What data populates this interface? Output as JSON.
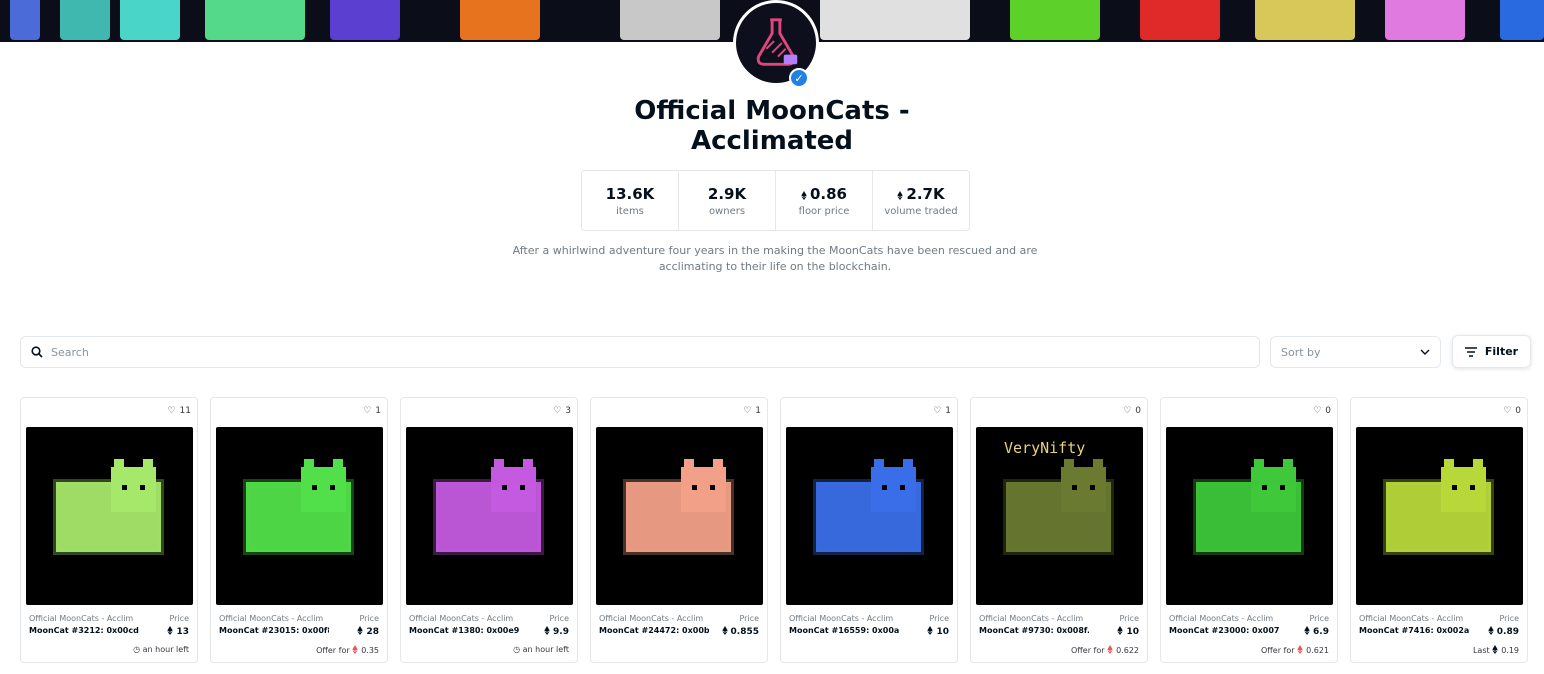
{
  "collection": {
    "title": "Official MoonCats - Acclimated",
    "description": "After a whirlwind adventure four years in the making the MoonCats have been rescued and are acclimating to their life on the blockchain.",
    "stats": [
      {
        "value": "13.6K",
        "label": "items",
        "eth": false
      },
      {
        "value": "2.9K",
        "label": "owners",
        "eth": false
      },
      {
        "value": "0.86",
        "label": "floor price",
        "eth": true
      },
      {
        "value": "2.7K",
        "label": "volume traded",
        "eth": true
      }
    ]
  },
  "toolbar": {
    "search_placeholder": "Search",
    "sort_label": "Sort by",
    "filter_label": "Filter"
  },
  "colors": {
    "accent": "#2081e2",
    "offer_eth": "#eb5757"
  },
  "items": [
    {
      "favorites": "11",
      "collection": "Official MoonCats - Acclim",
      "name": "MoonCat #3212: 0x00cd...",
      "price_label": "Price",
      "price": "13",
      "footer_type": "time",
      "footer_label": "",
      "footer_value": "an hour left",
      "cat_color": "#a6e86a"
    },
    {
      "favorites": "1",
      "collection": "Official MoonCats - Acclim",
      "name": "MoonCat #23015: 0x00f8...",
      "price_label": "Price",
      "price": "28",
      "footer_type": "offer",
      "footer_label": "Offer for",
      "footer_value": "0.35",
      "cat_color": "#52e04a"
    },
    {
      "favorites": "3",
      "collection": "Official MoonCats - Acclim",
      "name": "MoonCat #1380: 0x00e9...",
      "price_label": "Price",
      "price": "9.9",
      "footer_type": "time",
      "footer_label": "",
      "footer_value": "an hour left",
      "cat_color": "#c45adf"
    },
    {
      "favorites": "1",
      "collection": "Official MoonCats - Acclim",
      "name": "MoonCat #24472: 0x00b...",
      "price_label": "Price",
      "price": "0.855",
      "footer_type": "none",
      "footer_label": "",
      "footer_value": "",
      "cat_color": "#f2a088"
    },
    {
      "favorites": "1",
      "collection": "Official MoonCats - Acclim",
      "name": "MoonCat #16559: 0x00a...",
      "price_label": "Price",
      "price": "10",
      "footer_type": "none",
      "footer_label": "",
      "footer_value": "",
      "cat_color": "#3a6ee8"
    },
    {
      "favorites": "0",
      "collection": "Official MoonCats - Acclim",
      "name": "MoonCat #9730: 0x008f...",
      "price_label": "Price",
      "price": "10",
      "footer_type": "offer",
      "footer_label": "Offer for",
      "footer_value": "0.622",
      "cat_color": "#6a7a30",
      "overlay_text": "VeryNifty"
    },
    {
      "favorites": "0",
      "collection": "Official MoonCats - Acclim",
      "name": "MoonCat #23000: 0x007...",
      "price_label": "Price",
      "price": "6.9",
      "footer_type": "offer",
      "footer_label": "Offer for",
      "footer_value": "0.621",
      "cat_color": "#3ec83a"
    },
    {
      "favorites": "0",
      "collection": "Official MoonCats - Acclim",
      "name": "MoonCat #7416: 0x002a...",
      "price_label": "Price",
      "price": "0.89",
      "footer_type": "last",
      "footer_label": "Last",
      "footer_value": "0.19",
      "cat_color": "#b8d83a"
    }
  ]
}
